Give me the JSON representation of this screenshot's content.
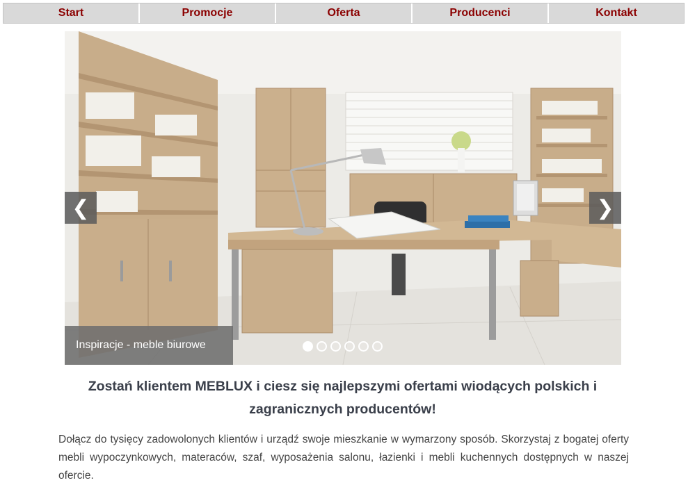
{
  "nav": {
    "items": [
      {
        "label": "Start"
      },
      {
        "label": "Promocje"
      },
      {
        "label": "Oferta"
      },
      {
        "label": "Producenci"
      },
      {
        "label": "Kontakt"
      }
    ]
  },
  "slider": {
    "caption": "Inspiracje - meble biurowe",
    "prev_icon": "❮",
    "next_icon": "❯",
    "dot_count": 6,
    "active_dot": 1
  },
  "content": {
    "headline": "Zostań klientem MEBLUX i ciesz się najlepszymi ofertami wiodących polskich i zagranicznych producentów!",
    "paragraph": "Dołącz do tysięcy zadowolonych klientów i urządź swoje mieszkanie w wymarzony sposób. Skorzystaj z bogatej oferty mebli wypoczynkowych, materaców, szaf, wyposażenia salonu, łazienki i mebli kuchennych dostępnych w naszej ofercie."
  },
  "colors": {
    "nav_bg": "#d9d9d9",
    "nav_text": "#8b0000",
    "headline": "#3a3f4a"
  }
}
